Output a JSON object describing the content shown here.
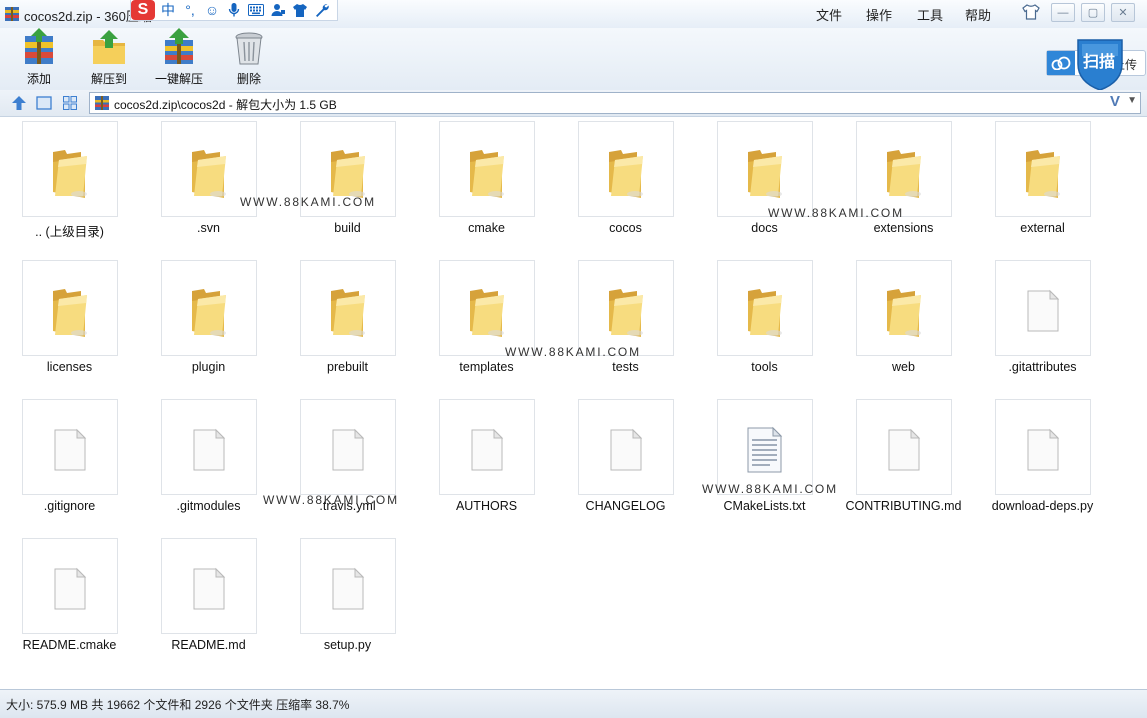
{
  "window": {
    "title": "cocos2d.zip - 360压缩"
  },
  "ime": {
    "mode": "中",
    "punct": "°,"
  },
  "menu": {
    "file": "文件",
    "actions": "操作",
    "tools": "工具",
    "help": "帮助"
  },
  "upload": {
    "label": "拖拽上传",
    "scan_label": "扫描"
  },
  "toolbar": {
    "add": "添加",
    "extract_to": "解压到",
    "one_click_extract": "一键解压",
    "delete": "删除"
  },
  "address": {
    "path": "cocos2d.zip\\cocos2d - 解包大小为 1.5 GB",
    "v_mark": "V"
  },
  "files": [
    {
      "name": ".. (上级目录)",
      "type": "folder"
    },
    {
      "name": ".svn",
      "type": "folder"
    },
    {
      "name": "build",
      "type": "folder"
    },
    {
      "name": "cmake",
      "type": "folder"
    },
    {
      "name": "cocos",
      "type": "folder"
    },
    {
      "name": "docs",
      "type": "folder"
    },
    {
      "name": "extensions",
      "type": "folder"
    },
    {
      "name": "external",
      "type": "folder"
    },
    {
      "name": "licenses",
      "type": "folder"
    },
    {
      "name": "plugin",
      "type": "folder"
    },
    {
      "name": "prebuilt",
      "type": "folder"
    },
    {
      "name": "templates",
      "type": "folder"
    },
    {
      "name": "tests",
      "type": "folder"
    },
    {
      "name": "tools",
      "type": "folder"
    },
    {
      "name": "web",
      "type": "folder"
    },
    {
      "name": ".gitattributes",
      "type": "file"
    },
    {
      "name": ".gitignore",
      "type": "file"
    },
    {
      "name": ".gitmodules",
      "type": "file"
    },
    {
      "name": ".travis.yml",
      "type": "file"
    },
    {
      "name": "AUTHORS",
      "type": "file"
    },
    {
      "name": "CHANGELOG",
      "type": "file"
    },
    {
      "name": "CMakeLists.txt",
      "type": "text"
    },
    {
      "name": "CONTRIBUTING.md",
      "type": "file"
    },
    {
      "name": "download-deps.py",
      "type": "file"
    },
    {
      "name": "README.cmake",
      "type": "file"
    },
    {
      "name": "README.md",
      "type": "file"
    },
    {
      "name": "setup.py",
      "type": "file"
    }
  ],
  "watermark": "WWW.88KAMI.COM",
  "status": {
    "text": "大小: 575.9 MB 共 19662 个文件和 2926 个文件夹 压缩率 38.7%"
  }
}
